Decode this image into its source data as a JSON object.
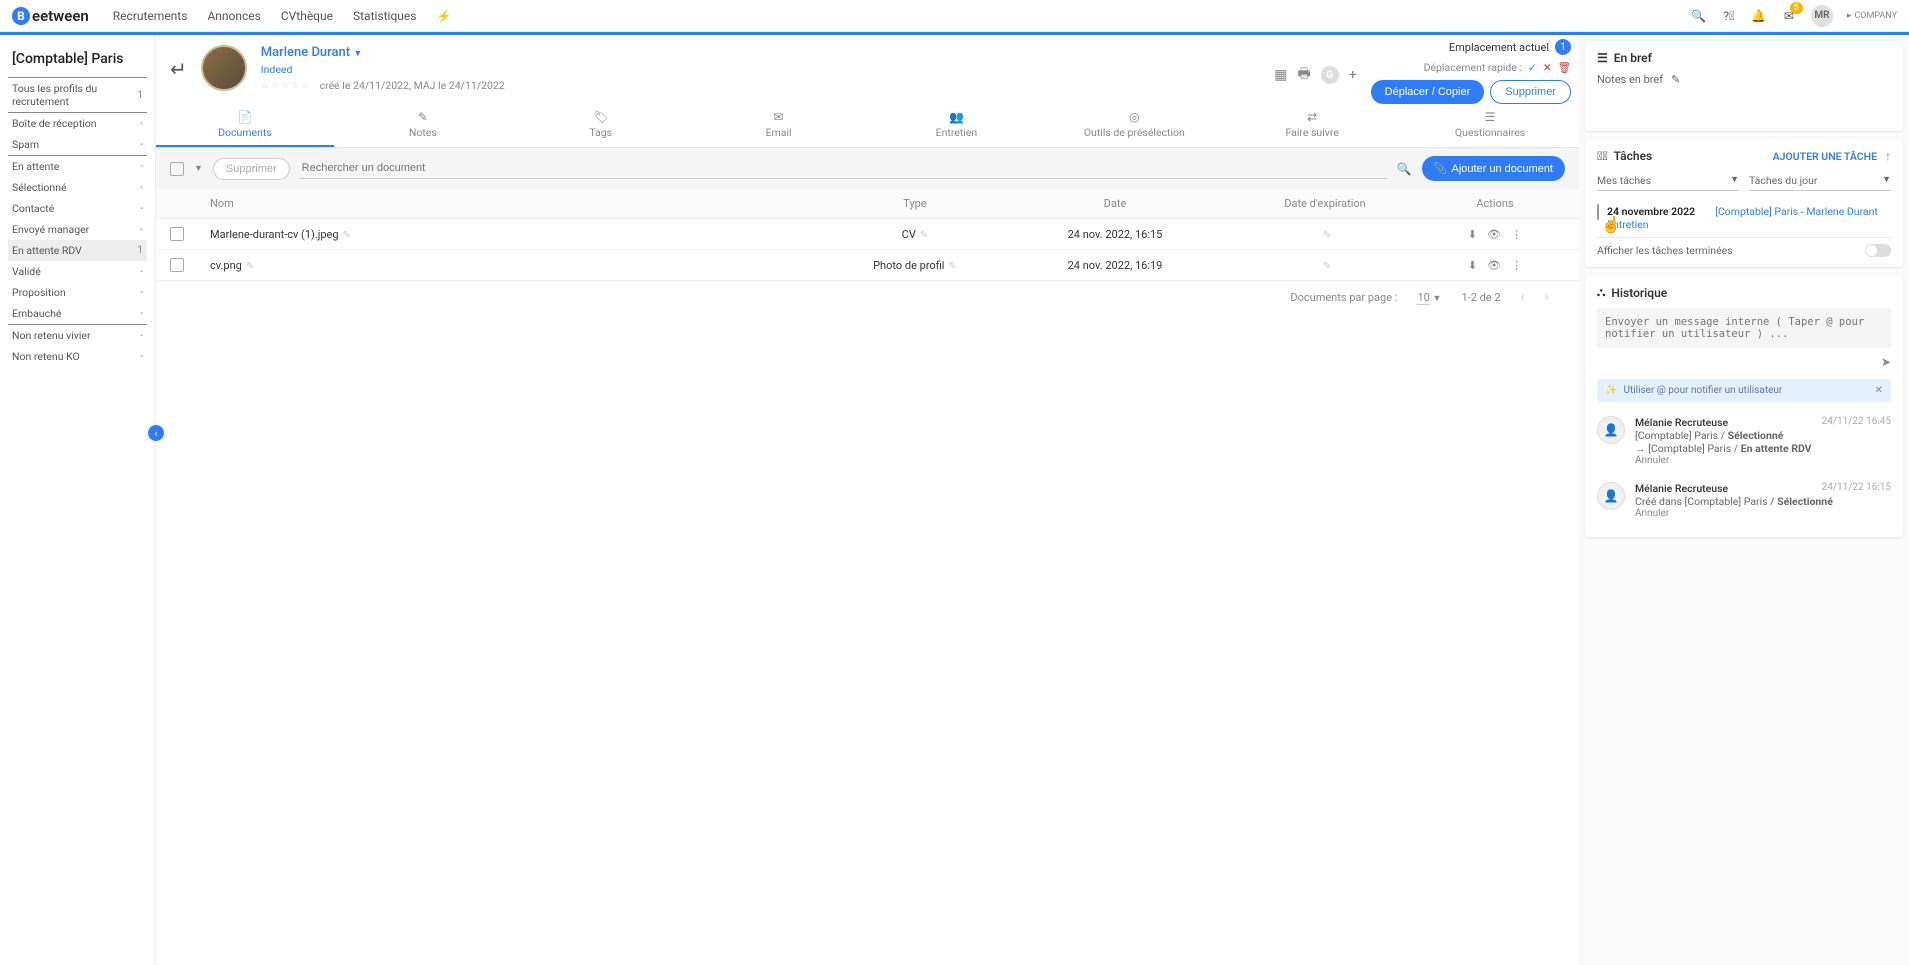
{
  "logo_text": "eetween",
  "nav": [
    "Recrutements",
    "Annonces",
    "CVthèque",
    "Statistiques"
  ],
  "notif_count": "5",
  "user_initials": "MR",
  "company": "COMPANY",
  "sidebar": {
    "title": "[Comptable] Paris",
    "group1": [
      {
        "label": "Tous les profils du recrutement",
        "count": "1"
      }
    ],
    "group2": [
      {
        "label": "Boîte de réception",
        "count": "-"
      },
      {
        "label": "Spam",
        "count": "-"
      }
    ],
    "group3": [
      {
        "label": "En attente",
        "count": "-"
      },
      {
        "label": "Sélectionné",
        "count": "-"
      },
      {
        "label": "Contacté",
        "count": "-"
      },
      {
        "label": "Envoyé manager",
        "count": "-"
      },
      {
        "label": "En attente RDV",
        "count": "1",
        "active": true
      },
      {
        "label": "Validé",
        "count": "-"
      },
      {
        "label": "Proposition",
        "count": "-"
      },
      {
        "label": "Embauché",
        "count": "-"
      }
    ],
    "group4": [
      {
        "label": "Non retenu vivier",
        "count": "-"
      },
      {
        "label": "Non retenu KO",
        "count": "-"
      }
    ]
  },
  "candidate": {
    "name": "Marlene Durant",
    "source": "Indeed",
    "meta": "créé le 24/11/2022, MAJ le 24/11/2022"
  },
  "header_right": {
    "emplacement_label": "Emplacement actuel",
    "emplacement_count": "1",
    "deplacement_label": "Déplacement rapide :",
    "move_btn": "Déplacer / Copier",
    "delete_btn": "Supprimer"
  },
  "tabs": [
    "Documents",
    "Notes",
    "Tags",
    "Email",
    "Entretien",
    "Outils de présélection",
    "Faire suivre",
    "Questionnaires"
  ],
  "doc_toolbar": {
    "delete": "Supprimer",
    "search_placeholder": "Rechercher un document",
    "add": "Ajouter un document"
  },
  "doc_table": {
    "headers": {
      "name": "Nom",
      "type": "Type",
      "date": "Date",
      "exp": "Date d'expiration",
      "actions": "Actions"
    },
    "rows": [
      {
        "name": "Marlene-durant-cv (1).jpeg",
        "type": "CV",
        "date": "24 nov. 2022, 16:15",
        "exp": ""
      },
      {
        "name": "cv.png",
        "type": "Photo de profil",
        "date": "24 nov. 2022, 16:19",
        "exp": ""
      }
    ]
  },
  "pagination": {
    "label": "Documents par page :",
    "per_page": "10",
    "range": "1-2 de 2"
  },
  "right": {
    "en_bref": "En bref",
    "notes_label": "Notes en bref",
    "tasks_title": "Tâches",
    "add_task": "AJOUTER UNE TÂCHE",
    "sel1": "Mes tâches",
    "sel2": "Tâches du jour",
    "task": {
      "date": "24 novembre 2022",
      "link1": "[Comptable] Paris",
      "link2": "Marlene Durant",
      "type": "Entretien"
    },
    "toggle_label": "Afficher les tâches terminées",
    "hist_title": "Historique",
    "msg_placeholder": "Envoyer un message interne ( Taper @ pour notifier un utilisateur ) ...",
    "tip": "Utiliser @ pour notifier un utilisateur",
    "hist": [
      {
        "user": "Mélanie Recruteuse",
        "time": "24/11/22 16:45",
        "line1_pre": "[Comptable] Paris / ",
        "line1_bold": "Sélectionné",
        "line2_pre": "→ [Comptable] Paris / ",
        "line2_bold": "En attente RDV",
        "annuler": "Annuler"
      },
      {
        "user": "Mélanie Recruteuse",
        "time": "24/11/22 16:15",
        "line1_pre": "Créé dans [Comptable] Paris / ",
        "line1_bold": "Sélectionné",
        "annuler": "Annuler"
      }
    ]
  }
}
